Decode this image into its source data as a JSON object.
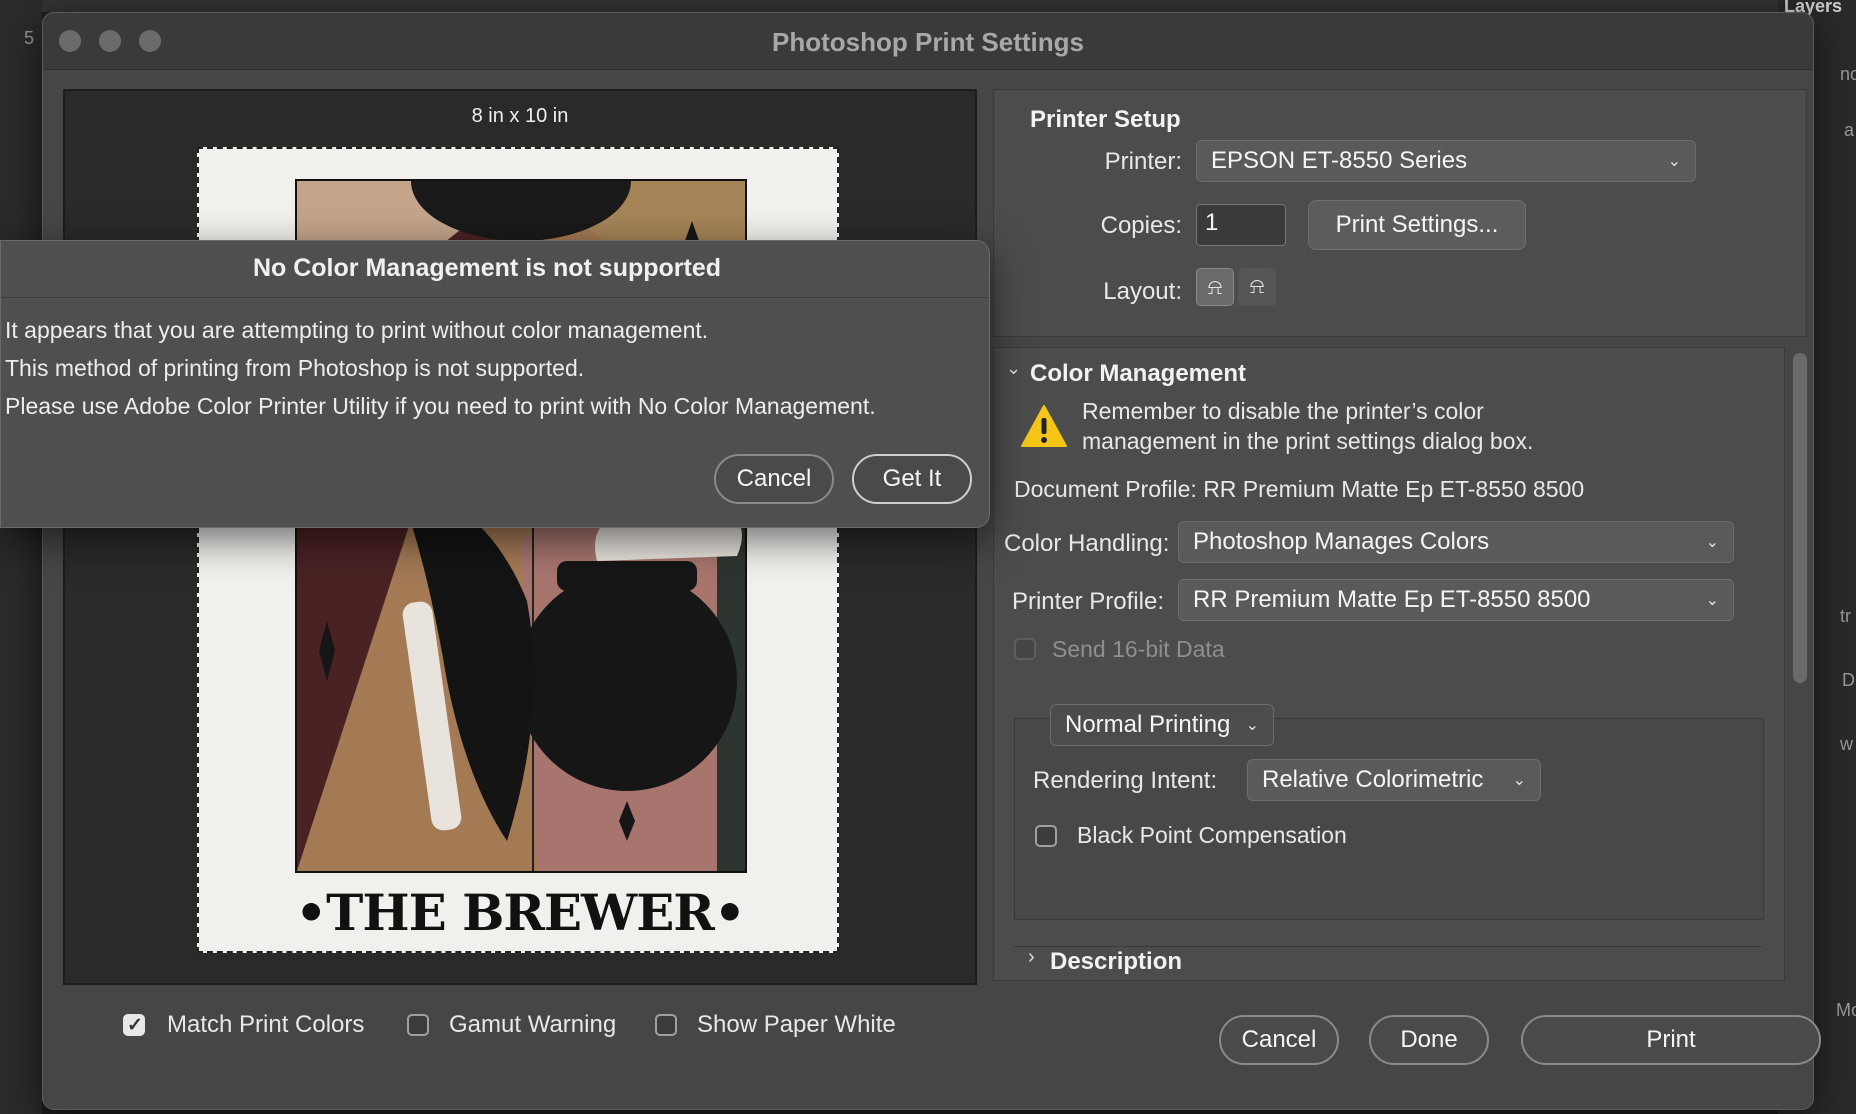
{
  "background": {
    "left_tab": "5",
    "right_panel_title": "Layers",
    "right_edge_letters": [
      "nc",
      "a",
      "tr",
      "D",
      "w",
      "Mo"
    ]
  },
  "window": {
    "title": "Photoshop Print Settings"
  },
  "preview": {
    "paper_size": "8 in x 10 in",
    "card_title": "•THE BREWER•",
    "options": [
      {
        "label": "Match Print Colors",
        "checked": true
      },
      {
        "label": "Gamut Warning",
        "checked": false
      },
      {
        "label": "Show Paper White",
        "checked": false
      }
    ]
  },
  "printer_setup": {
    "title": "Printer Setup",
    "printer_label": "Printer:",
    "printer_value": "EPSON ET-8550 Series",
    "copies_label": "Copies:",
    "copies_value": "1",
    "print_settings_button": "Print Settings...",
    "layout_label": "Layout:",
    "layout_icons": [
      "portrait-layout-icon",
      "landscape-layout-icon"
    ]
  },
  "color_management": {
    "title": "Color Management",
    "warning_line1": "Remember to disable the printer’s color",
    "warning_line2": "management in the print settings dialog box.",
    "document_profile": "Document Profile: RR Premium Matte Ep ET-8550 8500",
    "color_handling_label": "Color Handling:",
    "color_handling_value": "Photoshop Manages Colors",
    "printer_profile_label": "Printer Profile:",
    "printer_profile_value": "RR Premium Matte Ep ET-8550 8500",
    "send16_label": "Send 16-bit Data",
    "printing_mode": "Normal Printing",
    "rendering_intent_label": "Rendering Intent:",
    "rendering_intent_value": "Relative Colorimetric",
    "bpc_label": "Black Point Compensation",
    "description_title": "Description"
  },
  "footer": {
    "cancel": "Cancel",
    "done": "Done",
    "print": "Print"
  },
  "alert": {
    "title": "No Color Management is not supported",
    "line1": "It appears that you are attempting to print without color management.",
    "line2": "This method of printing from Photoshop is not supported.",
    "line3": "Please use Adobe Color Printer Utility if you need to print with No Color Management.",
    "cancel": "Cancel",
    "get_it": "Get It"
  },
  "colors": {
    "window_bg": "#464646",
    "panel_bg": "#4c4c4c",
    "warning_yellow": "#f5c518",
    "art_tan": "#a47a55",
    "art_maroon": "#4a2224",
    "art_rose": "#a8756e"
  }
}
